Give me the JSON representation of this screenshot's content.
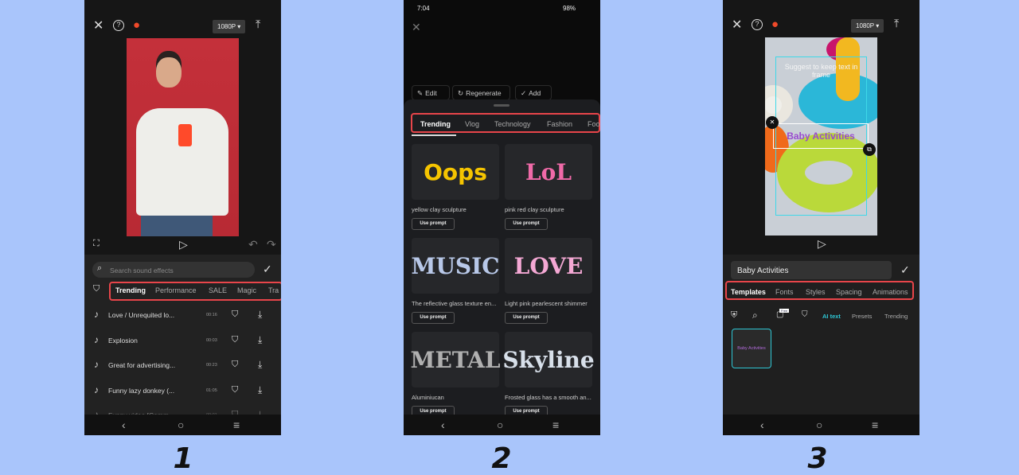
{
  "colors": {
    "background": "#a9c5fb",
    "highlight": "#e8454a",
    "accent": "#2ec6d4"
  },
  "labels": [
    "1",
    "2",
    "3"
  ],
  "p1": {
    "resolution": "1080P ▾",
    "search_placeholder": "Search sound effects",
    "tabs": [
      "Trending",
      "Performance",
      "SALE",
      "Magic",
      "Tra"
    ],
    "sounds": [
      {
        "title": "Love / Unrequited lo...",
        "duration": "00:16"
      },
      {
        "title": "Explosion",
        "duration": "00:03"
      },
      {
        "title": "Great for advertising...",
        "duration": "00:23"
      },
      {
        "title": "Funny lazy donkey (...",
        "duration": "01:05"
      },
      {
        "title": "Funny video [Comm...",
        "duration": "00:01"
      }
    ]
  },
  "p2": {
    "status": {
      "time": "7:04",
      "battery": "98%"
    },
    "actions": [
      "Edit",
      "Regenerate",
      "Add"
    ],
    "tabs": [
      "Trending",
      "Vlog",
      "Technology",
      "Fashion",
      "Foo"
    ],
    "use_prompt": "Use prompt",
    "cards": [
      {
        "art": "Oops",
        "caption": "yellow clay sculpture",
        "color": "#f5c400"
      },
      {
        "art": "LoL",
        "caption": "pink red clay sculpture",
        "color": "#f06aa8"
      },
      {
        "art": "MUSIC",
        "caption": "The reflective glass texture en...",
        "color": "#b8c8e8"
      },
      {
        "art": "LOVE",
        "caption": "Light pink pearlescent shimmer",
        "color": "#f4a8d4"
      },
      {
        "art": "METAL",
        "caption": "Aluminiucan",
        "color": "#b0b0b0"
      },
      {
        "art": "Skyline",
        "caption": "Frosted glass has a smooth an...",
        "color": "#d8e0ea"
      }
    ]
  },
  "p3": {
    "resolution": "1080P ▾",
    "frame_hint": "Suggest to keep text in frame",
    "overlay_text": "Baby Activities",
    "input_value": "Baby Activities",
    "tabs": [
      "Templates",
      "Fonts",
      "Styles",
      "Spacing",
      "Animations"
    ],
    "subtabs": [
      "AI text",
      "Presets",
      "Trending"
    ],
    "free_badge": "Free",
    "template_label": "Baby Activities"
  }
}
